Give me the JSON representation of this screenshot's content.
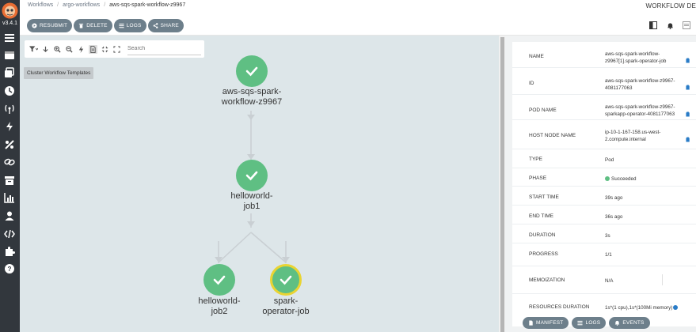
{
  "nav": {
    "version": "v3.4.1",
    "items": [
      "menu-icon",
      "workflows-icon",
      "templates-icon",
      "cron-icon",
      "sensors-icon",
      "event-sources-icon",
      "event-flow-icon",
      "link-icon",
      "archive-icon",
      "reports-icon",
      "user-icon",
      "api-docs-icon",
      "plugins-icon",
      "help-icon"
    ]
  },
  "breadcrumbs": [
    "Workflows",
    "argo-workflows",
    "aws-sqs-spark-workflow-z9967"
  ],
  "header": {
    "title_right": "WORKFLOW DE",
    "actions": [
      {
        "label": "RESUBMIT",
        "icon": "resubmit-icon"
      },
      {
        "label": "DELETE",
        "icon": "trash-icon"
      },
      {
        "label": "LOGS",
        "icon": "list-icon"
      },
      {
        "label": "SHARE",
        "icon": "share-icon"
      }
    ]
  },
  "graph_toolbar": {
    "search_placeholder": "Search",
    "tooltip": "Cluster Workflow Templates"
  },
  "graph": {
    "nodes": [
      {
        "label_line1": "aws-sqs-spark-",
        "label_line2": "workflow-z9967",
        "status": "succeeded",
        "selected": false
      },
      {
        "label_line1": "helloworld-",
        "label_line2": "job1",
        "status": "succeeded",
        "selected": false
      },
      {
        "label_line1": "helloworld-",
        "label_line2": "job2",
        "status": "succeeded",
        "selected": false
      },
      {
        "label_line1": "spark-",
        "label_line2": "operator-job",
        "status": "succeeded",
        "selected": true
      }
    ]
  },
  "details": {
    "rows": [
      {
        "key": "NAME",
        "value": "aws-sqs-spark-workflow-z9967[1].spark-operator-job",
        "copy": true
      },
      {
        "key": "ID",
        "value": "aws-sqs-spark-workflow-z9967-4081177063",
        "copy": true
      },
      {
        "key": "POD NAME",
        "value": "aws-sqs-spark-workflow-z9967-sparkapp-operator-4081177063",
        "copy": true
      },
      {
        "key": "HOST NODE NAME",
        "value": "ip-10-1-167-158.us-west-2.compute.internal",
        "copy": true
      },
      {
        "key": "TYPE",
        "value": "Pod",
        "copy": false
      },
      {
        "key": "PHASE",
        "value": "Succeeded",
        "copy": false
      },
      {
        "key": "START TIME",
        "value": "39s ago",
        "copy": false
      },
      {
        "key": "END TIME",
        "value": "36s ago",
        "copy": false
      },
      {
        "key": "DURATION",
        "value": "3s",
        "copy": false
      },
      {
        "key": "PROGRESS",
        "value": "1/1",
        "copy": false
      },
      {
        "key": "MEMOIZATION",
        "value": "N/A",
        "copy": false
      },
      {
        "key": "RESOURCES DURATION",
        "value": "1s*(1 cpu),1s*(100Mi memory)",
        "copy": false
      }
    ],
    "buttons": [
      {
        "label": "MANIFEST",
        "icon": "file-icon"
      },
      {
        "label": "LOGS",
        "icon": "list-icon"
      },
      {
        "label": "EVENTS",
        "icon": "bell-icon"
      }
    ]
  },
  "colors": {
    "nav_bg": "#32373d",
    "button_bg": "#6d7f8b",
    "node_success": "#5fbf83",
    "node_selected_ring": "#e9d432",
    "graph_bg": "#dde6e9"
  }
}
